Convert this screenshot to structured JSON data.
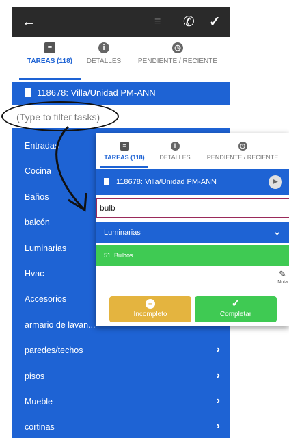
{
  "colors": {
    "primary": "#1e63d4",
    "success": "#3fca53",
    "warning": "#e4b43f",
    "topbar": "#2a2a2a"
  },
  "topbar": {
    "back_icon": "arrow-left-icon",
    "list_icon": "outdent-icon",
    "phone_icon": "phone-icon",
    "check_icon": "check-icon"
  },
  "tabs": [
    {
      "label": "TAREAS (118)",
      "icon": "list-icon",
      "active": true
    },
    {
      "label": "DETALLES",
      "icon": "info-icon",
      "active": false
    },
    {
      "label": "PENDIENTE / RECIENTE",
      "icon": "clock-icon",
      "active": false
    }
  ],
  "property": {
    "title": "118678: Villa/Unidad PM-ANN"
  },
  "filter": {
    "placeholder": "(Type to filter tasks)",
    "value": ""
  },
  "categories": [
    "Entradas",
    "Cocina",
    "Baños",
    "balcón",
    "Luminarias",
    "Hvac",
    "Accesorios",
    "armario de lavan...",
    "paredes/techos",
    "pisos",
    "Mueble",
    "cortinas"
  ],
  "inset": {
    "tabs": [
      {
        "label": "TAREAS (118)",
        "active": true
      },
      {
        "label": "DETALLES",
        "active": false
      },
      {
        "label": "PENDIENTE / RECIENTE",
        "active": false
      }
    ],
    "property_title": "118678: Villa/Unidad PM-ANN",
    "search_value": "bulb",
    "group": "Luminarias",
    "item": "51. Bulbos",
    "note_label": "Nota",
    "buttons": {
      "incomplete": "Incompleto",
      "complete": "Completar"
    }
  }
}
